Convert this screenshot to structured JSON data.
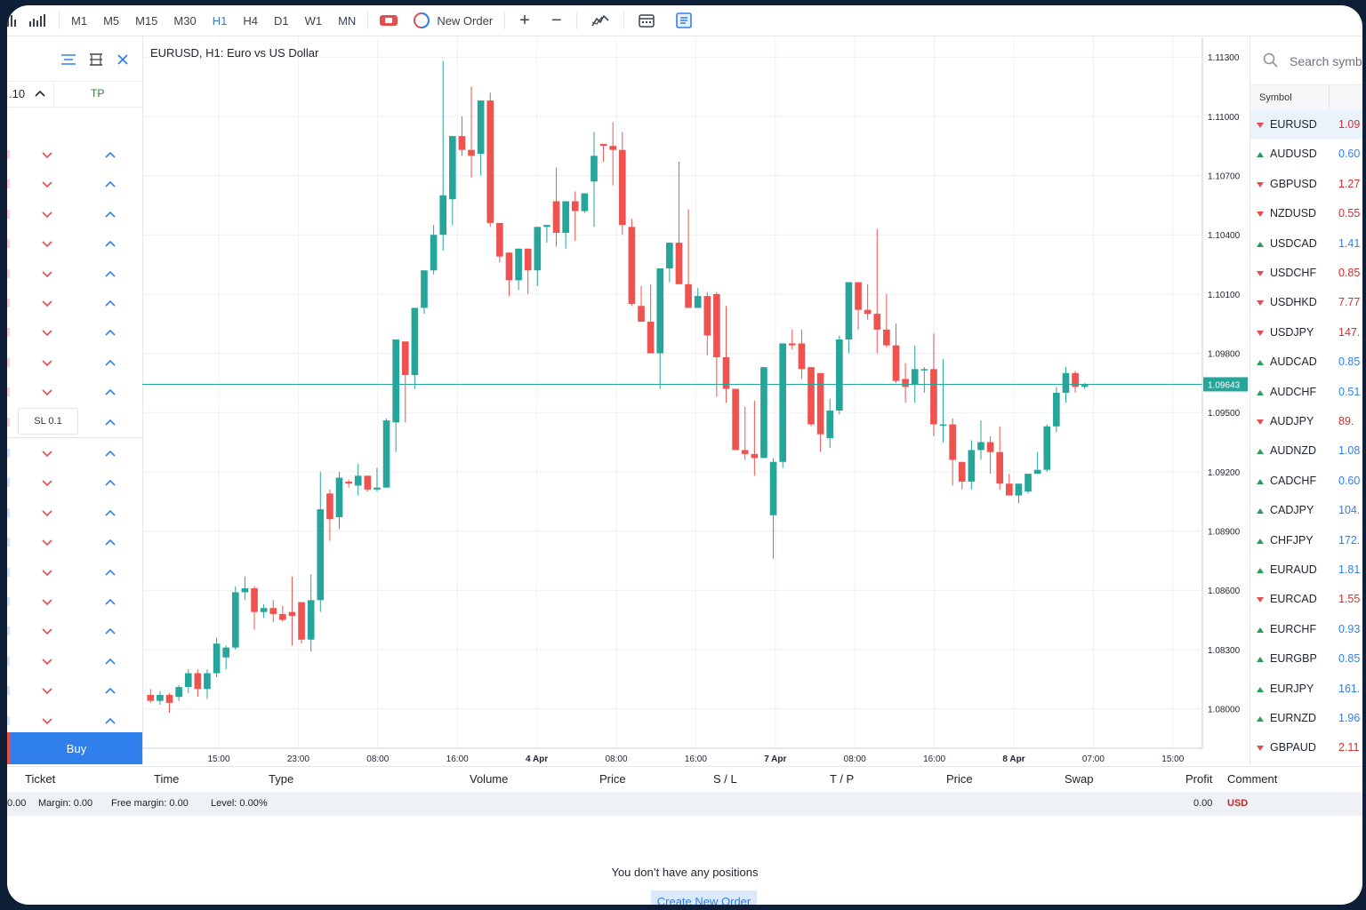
{
  "toolbar": {
    "timeframes": [
      "M1",
      "M5",
      "M15",
      "M30",
      "H1",
      "H4",
      "D1",
      "W1",
      "MN"
    ],
    "active_timeframe": "H1",
    "new_order_label": "New Order"
  },
  "chart_data": {
    "type": "candlestick",
    "title": "EURUSD, H1: Euro vs US Dollar",
    "ylim": [
      1.078,
      1.114
    ],
    "y_ticks": [
      "1.11300",
      "1.11000",
      "1.10700",
      "1.10400",
      "1.10100",
      "1.09800",
      "1.09500",
      "1.09200",
      "1.08900",
      "1.08600",
      "1.08300",
      "1.08000"
    ],
    "x_ticks": [
      {
        "label": "15:00",
        "bold": false
      },
      {
        "label": "23:00",
        "bold": false
      },
      {
        "label": "08:00",
        "bold": false
      },
      {
        "label": "16:00",
        "bold": false
      },
      {
        "label": "4 Apr",
        "bold": true
      },
      {
        "label": "08:00",
        "bold": false
      },
      {
        "label": "16:00",
        "bold": false
      },
      {
        "label": "7 Apr",
        "bold": true
      },
      {
        "label": "08:00",
        "bold": false
      },
      {
        "label": "16:00",
        "bold": false
      },
      {
        "label": "8 Apr",
        "bold": true
      },
      {
        "label": "07:00",
        "bold": false
      },
      {
        "label": "15:00",
        "bold": false
      }
    ],
    "current_price": "1.09643",
    "current_price_value": 1.09643,
    "candles": [
      [
        1.0807,
        1.081,
        1.0803,
        1.0804
      ],
      [
        1.0804,
        1.0809,
        1.0802,
        1.0807
      ],
      [
        1.0807,
        1.0808,
        1.0798,
        1.0803
      ],
      [
        1.0806,
        1.0812,
        1.0804,
        1.0811
      ],
      [
        1.0811,
        1.082,
        1.0808,
        1.0818
      ],
      [
        1.0818,
        1.082,
        1.0806,
        1.081
      ],
      [
        1.081,
        1.082,
        1.0805,
        1.0818
      ],
      [
        1.0818,
        1.0836,
        1.0816,
        1.0833
      ],
      [
        1.0826,
        1.0832,
        1.082,
        1.0831
      ],
      [
        1.0831,
        1.0862,
        1.083,
        1.0859
      ],
      [
        1.0859,
        1.0867,
        1.0855,
        1.0861
      ],
      [
        1.0861,
        1.0862,
        1.084,
        1.0849
      ],
      [
        1.0849,
        1.0853,
        1.0846,
        1.0851
      ],
      [
        1.0851,
        1.0855,
        1.0844,
        1.0848
      ],
      [
        1.0848,
        1.0852,
        1.0844,
        1.0845
      ],
      [
        1.0849,
        1.0867,
        1.0832,
        1.0847
      ],
      [
        1.0854,
        1.0854,
        1.0833,
        1.0835
      ],
      [
        1.0835,
        1.0868,
        1.0829,
        1.0855
      ],
      [
        1.0855,
        1.092,
        1.0849,
        1.0901
      ],
      [
        1.0909,
        1.0911,
        1.0885,
        1.0896
      ],
      [
        1.0897,
        1.092,
        1.0891,
        1.0917
      ],
      [
        1.0915,
        1.0916,
        1.0912,
        1.0914
      ],
      [
        1.0913,
        1.0924,
        1.0908,
        1.0918
      ],
      [
        1.0918,
        1.0918,
        1.091,
        1.0911
      ],
      [
        1.0911,
        1.0922,
        1.091,
        1.0912
      ],
      [
        1.0912,
        1.0947,
        1.0912,
        1.0946
      ],
      [
        1.0945,
        1.0987,
        1.093,
        1.0987
      ],
      [
        1.0986,
        1.0986,
        1.0945,
        1.0969
      ],
      [
        1.0969,
        1.1003,
        1.0962,
        1.1003
      ],
      [
        1.1003,
        1.1022,
        1.1,
        1.1022
      ],
      [
        1.1022,
        1.1045,
        1.102,
        1.104
      ],
      [
        1.104,
        1.1128,
        1.1032,
        1.106
      ],
      [
        1.1058,
        1.109,
        1.1045,
        1.109
      ],
      [
        1.109,
        1.11,
        1.108,
        1.1083
      ],
      [
        1.1083,
        1.1115,
        1.1069,
        1.108
      ],
      [
        1.1081,
        1.1107,
        1.107,
        1.1108
      ],
      [
        1.1108,
        1.1112,
        1.1044,
        1.1046
      ],
      [
        1.1046,
        1.1041,
        1.1026,
        1.1029
      ],
      [
        1.1031,
        1.103,
        1.1009,
        1.1017
      ],
      [
        1.1017,
        1.1029,
        1.1012,
        1.1033
      ],
      [
        1.1033,
        1.1027,
        1.101,
        1.1022
      ],
      [
        1.1022,
        1.104,
        1.1014,
        1.1044
      ],
      [
        1.1044,
        1.1044,
        1.1036,
        1.1045
      ],
      [
        1.1057,
        1.1074,
        1.1034,
        1.1041
      ],
      [
        1.1041,
        1.1056,
        1.1033,
        1.1057
      ],
      [
        1.1057,
        1.1062,
        1.1037,
        1.1052
      ],
      [
        1.1052,
        1.1061,
        1.1051,
        1.1061
      ],
      [
        1.1067,
        1.1092,
        1.1044,
        1.108
      ],
      [
        1.1086,
        1.1079,
        1.1077,
        1.1085
      ],
      [
        1.1085,
        1.1097,
        1.1065,
        1.1083
      ],
      [
        1.1083,
        1.1092,
        1.104,
        1.1045
      ],
      [
        1.1044,
        1.1048,
        1.1004,
        1.1005
      ],
      [
        1.1004,
        1.1014,
        1.0997,
        1.0996
      ],
      [
        1.0996,
        1.1015,
        1.098,
        1.098
      ],
      [
        1.098,
        1.1021,
        1.0962,
        1.1023
      ],
      [
        1.1023,
        1.1036,
        1.1016,
        1.1036
      ],
      [
        1.1036,
        1.1077,
        1.1021,
        1.1015
      ],
      [
        1.1015,
        1.1053,
        1.1009,
        1.1003
      ],
      [
        1.1003,
        1.1013,
        1.1005,
        1.1009
      ],
      [
        1.1009,
        1.1011,
        1.0979,
        1.0989
      ],
      [
        1.101,
        1.1011,
        1.0958,
        1.0978
      ],
      [
        1.0978,
        1.1004,
        1.0955,
        1.0962
      ],
      [
        1.0962,
        1.0951,
        1.0931,
        1.0931
      ],
      [
        1.0931,
        1.0953,
        1.0926,
        1.0929
      ],
      [
        1.0929,
        1.0956,
        1.0918,
        1.0927
      ],
      [
        1.0927,
        1.0971,
        1.093,
        1.0973
      ],
      [
        1.0898,
        1.0927,
        1.0876,
        1.0925
      ],
      [
        1.0925,
        1.0985,
        1.0922,
        1.0985
      ],
      [
        1.0985,
        1.0992,
        1.0982,
        1.0984
      ],
      [
        1.0985,
        1.0992,
        1.0967,
        1.0972
      ],
      [
        1.0973,
        1.0968,
        1.0943,
        1.0944
      ],
      [
        1.097,
        1.0956,
        1.093,
        1.0939
      ],
      [
        1.0937,
        1.0957,
        1.0932,
        1.0951
      ],
      [
        1.0951,
        1.0989,
        1.0949,
        1.0987
      ],
      [
        1.0987,
        1.1015,
        1.098,
        1.1016
      ],
      [
        1.1016,
        1.1009,
        1.0992,
        1.1002
      ],
      [
        1.1002,
        1.1015,
        1.0997,
        1.1
      ],
      [
        1.1,
        1.1043,
        1.098,
        1.0992
      ],
      [
        1.0992,
        1.101,
        1.0983,
        1.0984
      ],
      [
        1.0984,
        1.0995,
        1.0965,
        1.0966
      ],
      [
        1.0967,
        1.0975,
        1.0955,
        1.0963
      ],
      [
        1.0964,
        1.0984,
        1.0955,
        1.0972
      ],
      [
        1.0972,
        1.0973,
        1.096,
        1.0972
      ],
      [
        1.0972,
        1.099,
        1.0938,
        1.0944
      ],
      [
        1.0944,
        1.0977,
        1.0935,
        1.0944
      ],
      [
        1.0944,
        1.0947,
        1.0913,
        1.0926
      ],
      [
        1.0925,
        1.0917,
        1.0911,
        1.0915
      ],
      [
        1.0915,
        1.0936,
        1.0911,
        1.0931
      ],
      [
        1.0931,
        1.0946,
        1.0926,
        1.0935
      ],
      [
        1.0935,
        1.0938,
        1.0919,
        1.093
      ],
      [
        1.093,
        1.0943,
        1.0911,
        1.0914
      ],
      [
        1.0914,
        1.0919,
        1.091,
        1.0908
      ],
      [
        1.0908,
        1.0913,
        1.0904,
        1.0914
      ],
      [
        1.091,
        1.0917,
        1.0909,
        1.0919
      ],
      [
        1.0919,
        1.093,
        1.0919,
        1.0921
      ],
      [
        1.0921,
        1.0944,
        1.092,
        1.0943
      ],
      [
        1.0943,
        1.0963,
        1.094,
        1.096
      ],
      [
        1.096,
        1.0973,
        1.0955,
        1.097
      ],
      [
        1.097,
        1.0971,
        1.096,
        1.0963
      ],
      [
        1.0963,
        1.0965,
        1.0962,
        1.0964
      ]
    ]
  },
  "left_panel": {
    "qty_text": ".10",
    "tp_label": "TP",
    "sl_label": "SL 0.1",
    "buy_label": "Buy"
  },
  "right_panel": {
    "search_placeholder": "Search symbol",
    "symbol_header": "Symbol",
    "symbols": [
      {
        "name": "EURUSD",
        "price": "1.09",
        "dir": "down"
      },
      {
        "name": "AUDUSD",
        "price": "0.60",
        "dir": "up"
      },
      {
        "name": "GBPUSD",
        "price": "1.27",
        "dir": "down"
      },
      {
        "name": "NZDUSD",
        "price": "0.55",
        "dir": "down"
      },
      {
        "name": "USDCAD",
        "price": "1.41",
        "dir": "up"
      },
      {
        "name": "USDCHF",
        "price": "0.85",
        "dir": "down"
      },
      {
        "name": "USDHKD",
        "price": "7.77",
        "dir": "down"
      },
      {
        "name": "USDJPY",
        "price": "147.",
        "dir": "down"
      },
      {
        "name": "AUDCAD",
        "price": "0.85",
        "dir": "up"
      },
      {
        "name": "AUDCHF",
        "price": "0.51",
        "dir": "up"
      },
      {
        "name": "AUDJPY",
        "price": "89.",
        "dir": "down"
      },
      {
        "name": "AUDNZD",
        "price": "1.08",
        "dir": "up"
      },
      {
        "name": "CADCHF",
        "price": "0.60",
        "dir": "up"
      },
      {
        "name": "CADJPY",
        "price": "104.",
        "dir": "up"
      },
      {
        "name": "CHFJPY",
        "price": "172.",
        "dir": "up"
      },
      {
        "name": "EURAUD",
        "price": "1.81",
        "dir": "up"
      },
      {
        "name": "EURCAD",
        "price": "1.55",
        "dir": "down"
      },
      {
        "name": "EURCHF",
        "price": "0.93",
        "dir": "up"
      },
      {
        "name": "EURGBP",
        "price": "0.85",
        "dir": "up"
      },
      {
        "name": "EURJPY",
        "price": "161.",
        "dir": "up"
      },
      {
        "name": "EURNZD",
        "price": "1.96",
        "dir": "up"
      },
      {
        "name": "GBPAUD",
        "price": "2.11",
        "dir": "down"
      }
    ]
  },
  "positions": {
    "columns": [
      "Ticket",
      "Time",
      "Type",
      "Volume",
      "Price",
      "S / L",
      "T / P",
      "Price",
      "Swap",
      "Profit",
      "Comment"
    ],
    "status": {
      "balance_fragment": "0.00",
      "margin": "Margin: 0.00",
      "free_margin": "Free margin: 0.00",
      "level": "Level: 0.00%",
      "profit_total": "0.00",
      "currency": "USD"
    },
    "empty_message": "You don’t have any positions",
    "create_button": "Create New Order"
  },
  "colors": {
    "bull": "#26a69a",
    "bear": "#ef5350",
    "accent": "#2f80ed",
    "price_line": "#26a69a"
  }
}
